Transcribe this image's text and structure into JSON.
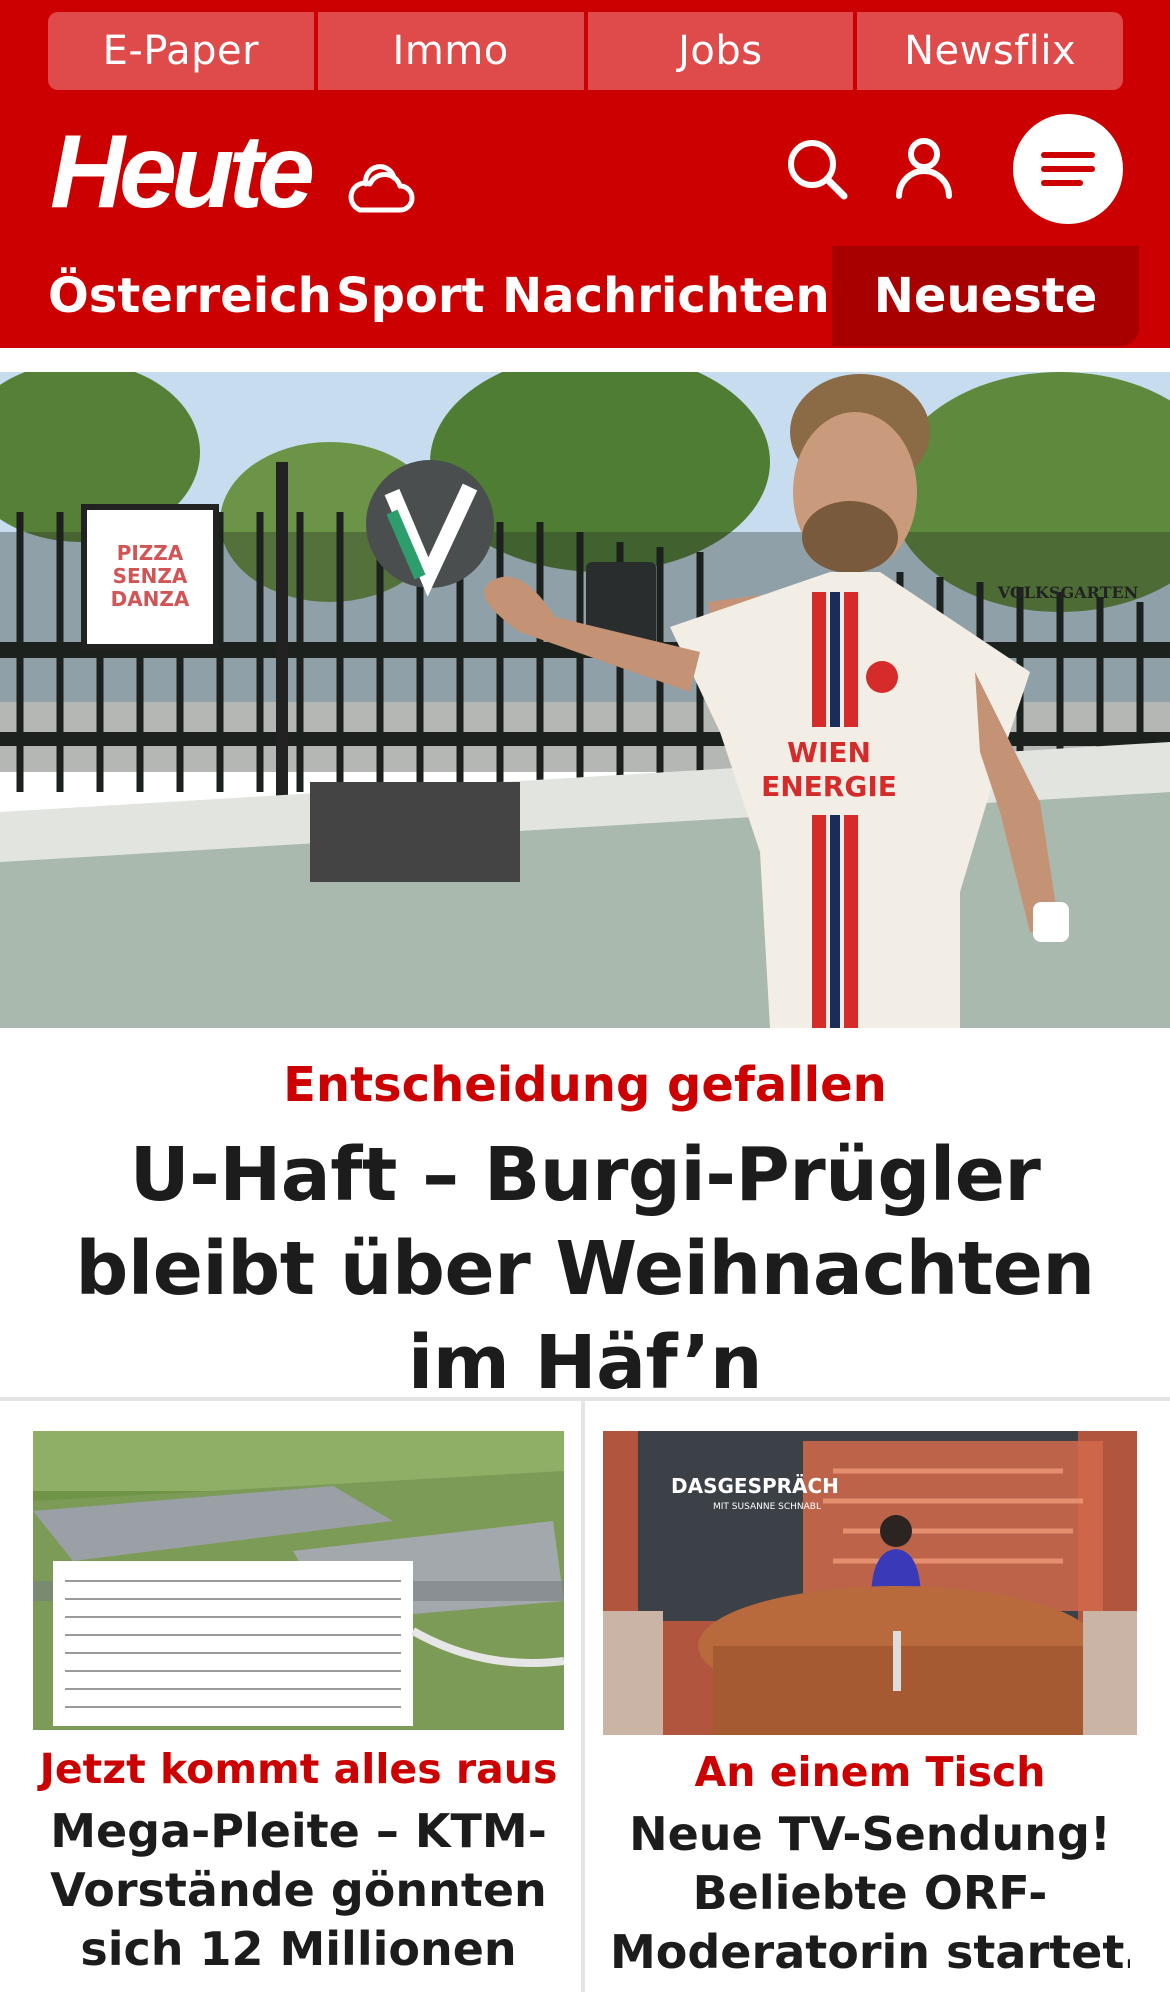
{
  "top_links": [
    "E-Paper",
    "Immo",
    "Jobs",
    "Newsflix"
  ],
  "header": {
    "logo_text": "Heute",
    "icons": [
      "weather-cloud-icon",
      "search-icon",
      "user-icon",
      "menu-icon"
    ]
  },
  "nav": {
    "items": [
      "Österreich",
      "Sport",
      "Nachrichten"
    ],
    "active": "Neueste"
  },
  "hero": {
    "image_text": {
      "sign": [
        "PIZZA",
        "SENZA",
        "DANZA"
      ],
      "street_sign": "VOLKSGARTEN",
      "jersey": [
        "WIEN",
        "ENERGIE"
      ]
    },
    "kicker": "Entscheidung gefallen",
    "headline": "U-Haft – Burgi-Prügler bleibt über Weihnachten im Häf’n"
  },
  "articles": [
    {
      "kicker": "Jetzt kommt alles raus",
      "headline": "Mega-Pleite – KTM-Vorstände gönnten sich 12 Millionen"
    },
    {
      "image_text": {
        "title": "DASGESPRÄCH",
        "subtitle": "MIT SUSANNE SCHNABL"
      },
      "kicker": "An einem Tisch",
      "headline": "Neue TV-Sendung! Beliebte ORF-Moderatorin startet…"
    }
  ],
  "colors": {
    "brand_red": "#cc0000",
    "nav_active": "#a80000",
    "toplink_bg": "#df4a4a",
    "text_dark": "#1c1c1c"
  }
}
